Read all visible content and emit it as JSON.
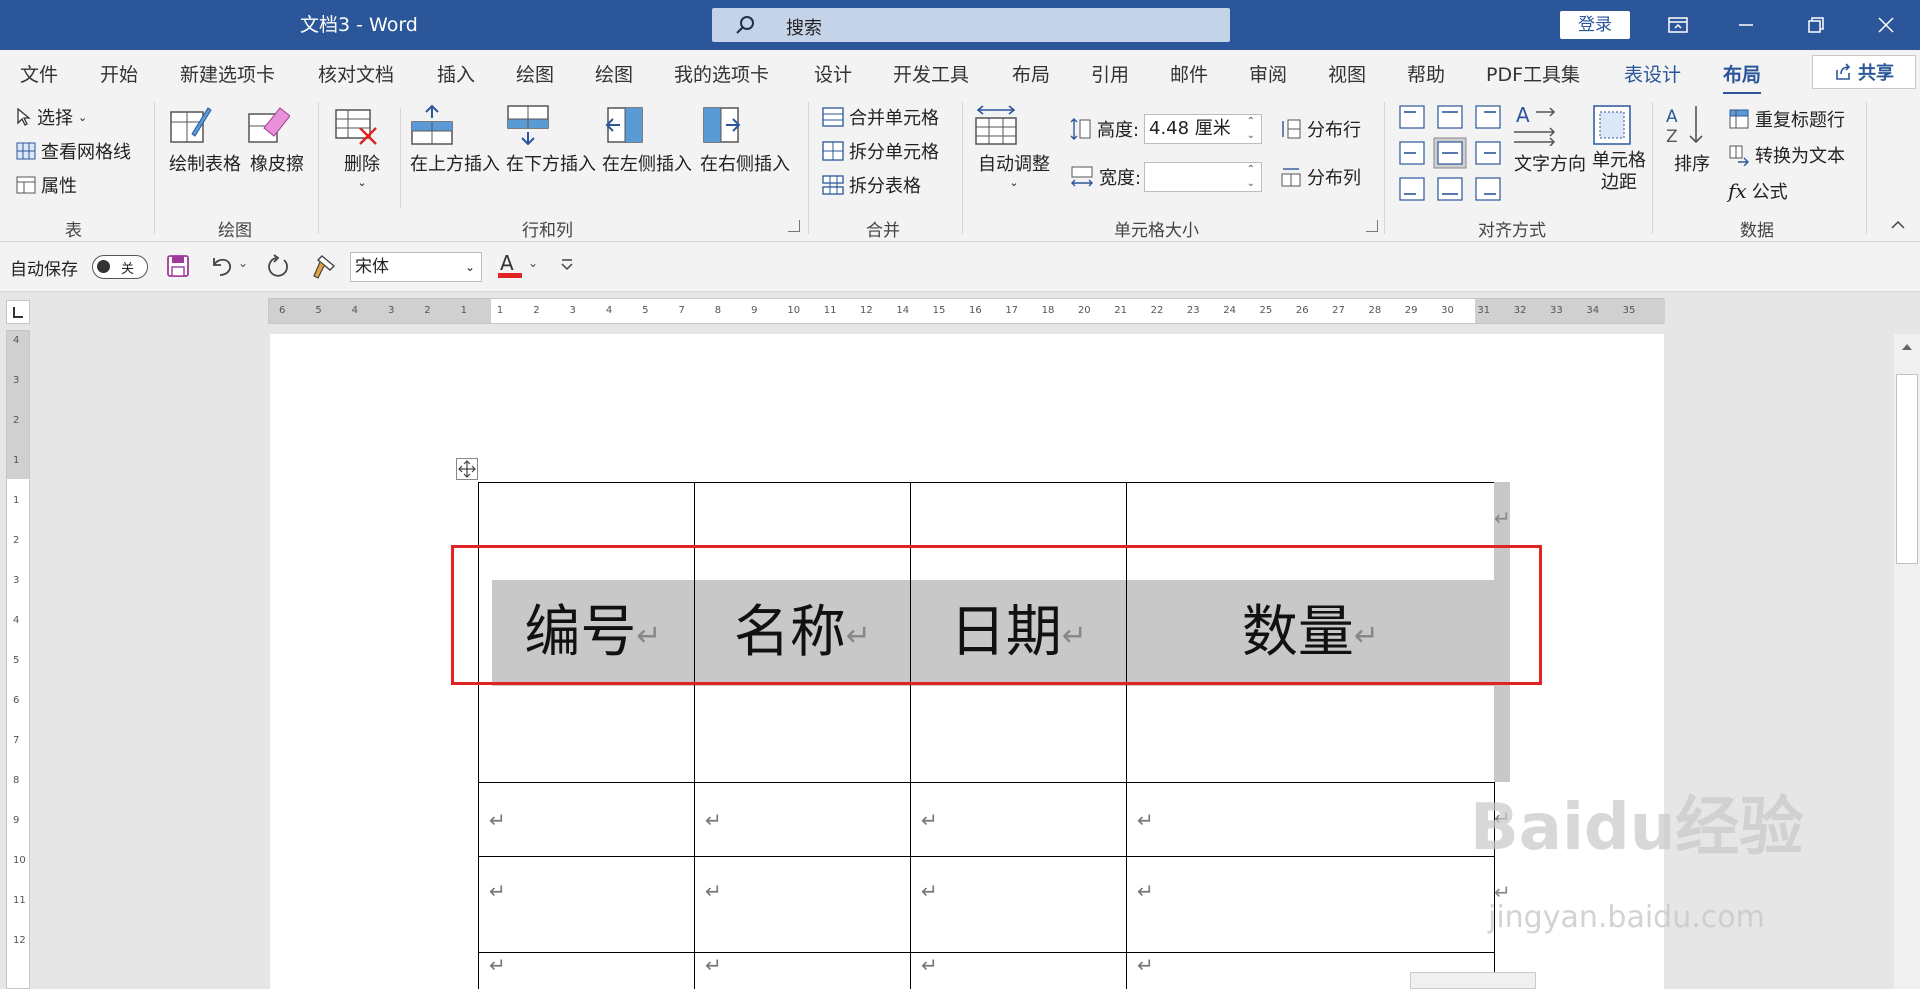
{
  "titlebar": {
    "doc_title": "文档3  -  Word",
    "search_label": "搜索",
    "login_label": "登录"
  },
  "tabs": [
    {
      "label": "文件"
    },
    {
      "label": "开始"
    },
    {
      "label": "新建选项卡"
    },
    {
      "label": "核对文档"
    },
    {
      "label": "插入"
    },
    {
      "label": "绘图"
    },
    {
      "label": "绘图"
    },
    {
      "label": "我的选项卡"
    },
    {
      "label": "设计"
    },
    {
      "label": "开发工具"
    },
    {
      "label": "布局"
    },
    {
      "label": "引用"
    },
    {
      "label": "邮件"
    },
    {
      "label": "审阅"
    },
    {
      "label": "视图"
    },
    {
      "label": "帮助"
    },
    {
      "label": "PDF工具集"
    },
    {
      "label": "表设计"
    },
    {
      "label": "布局"
    }
  ],
  "share_label": "共享",
  "ribbon": {
    "table": {
      "select": "选择",
      "view_gridlines": "查看网格线",
      "properties": "属性",
      "group": "表"
    },
    "draw": {
      "draw_table": "绘制表格",
      "eraser": "橡皮擦",
      "group": "绘图"
    },
    "rows_cols": {
      "delete": "删除",
      "insert_above": "在上方插入",
      "insert_below": "在下方插入",
      "insert_left": "在左侧插入",
      "insert_right": "在右侧插入",
      "group": "行和列"
    },
    "merge": {
      "merge_cells": "合并单元格",
      "split_cells": "拆分单元格",
      "split_table": "拆分表格",
      "group": "合并"
    },
    "cell_size": {
      "autofit": "自动调整",
      "height_label": "高度:",
      "height_value": "4.48 厘米",
      "width_label": "宽度:",
      "width_value": "",
      "distribute_rows": "分布行",
      "distribute_cols": "分布列",
      "group": "单元格大小"
    },
    "alignment": {
      "text_direction": "文字方向",
      "cell_margins_line1": "单元格",
      "cell_margins_line2": "边距",
      "group": "对齐方式"
    },
    "data": {
      "sort": "排序",
      "repeat_header": "重复标题行",
      "convert_to_text": "转换为文本",
      "formula": "公式",
      "group": "数据"
    }
  },
  "qat": {
    "autosave_label": "自动保存",
    "autosave_state": "关",
    "font_name": "宋体"
  },
  "hruler_labels": [
    "6",
    "5",
    "4",
    "3",
    "2",
    "1",
    "1",
    "2",
    "3",
    "4",
    "5",
    "7",
    "8",
    "9",
    "10",
    "11",
    "12",
    "14",
    "15",
    "16",
    "17",
    "18",
    "20",
    "21",
    "22",
    "23",
    "24",
    "25",
    "26",
    "27",
    "28",
    "29",
    "30",
    "31",
    "32",
    "33",
    "34",
    "35"
  ],
  "vruler_labels": [
    "4",
    "3",
    "2",
    "1",
    "1",
    "2",
    "3",
    "4",
    "5",
    "6",
    "7",
    "8",
    "9",
    "10",
    "11",
    "12"
  ],
  "document": {
    "header_row": [
      "编号",
      "名称",
      "日期",
      "数量"
    ],
    "paragraph_mark": "↵"
  },
  "watermark": {
    "brand": "Baidu经验",
    "url": "jingyan.baidu.com"
  },
  "colors": {
    "brand_blue": "#2b579a",
    "highlight_red": "#e02424",
    "selection_gray": "#c8c8c8"
  }
}
